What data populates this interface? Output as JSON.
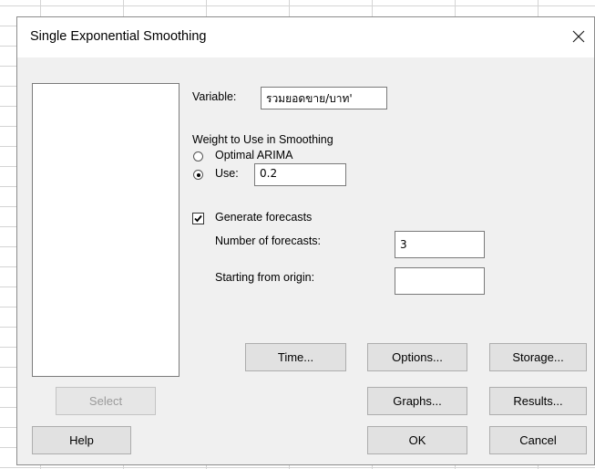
{
  "dialog": {
    "title": "Single Exponential Smoothing"
  },
  "variable": {
    "label": "Variable:",
    "value": "รวมยอดขาย/บาท'"
  },
  "weight": {
    "heading": "Weight to Use in Smoothing",
    "optimal_label": "Optimal ARIMA",
    "use_label": "Use:",
    "use_value": "0.2",
    "selected": "use"
  },
  "forecasts": {
    "generate_label": "Generate forecasts",
    "generate_checked": true,
    "number_label": "Number of forecasts:",
    "number_value": "3",
    "origin_label": "Starting from origin:",
    "origin_value": ""
  },
  "buttons": {
    "time": "Time...",
    "options": "Options...",
    "storage": "Storage...",
    "select": "Select",
    "graphs": "Graphs...",
    "results": "Results...",
    "help": "Help",
    "ok": "OK",
    "cancel": "Cancel"
  }
}
